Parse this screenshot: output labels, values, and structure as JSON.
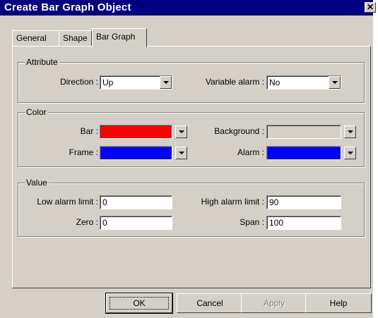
{
  "window": {
    "title": "Create Bar Graph  Object",
    "close_glyph": "✕"
  },
  "tabs": [
    {
      "label": "General"
    },
    {
      "label": "Shape"
    },
    {
      "label": "Bar Graph"
    }
  ],
  "attribute": {
    "legend": "Attribute",
    "direction_label": "Direction :",
    "direction_value": "Up",
    "variable_alarm_label": "Variable alarm :",
    "variable_alarm_value": "No"
  },
  "color": {
    "legend": "Color",
    "bar_label": "Bar :",
    "bar_color": "#ff0000",
    "background_label": "Background :",
    "background_color": "#d4d0c8",
    "frame_label": "Frame :",
    "frame_color": "#0000ff",
    "alarm_label": "Alarm :",
    "alarm_color": "#0000ff"
  },
  "value": {
    "legend": "Value",
    "low_alarm_label": "Low alarm limit :",
    "low_alarm_value": "0",
    "high_alarm_label": "High alarm limit :",
    "high_alarm_value": "90",
    "zero_label": "Zero :",
    "zero_value": "0",
    "span_label": "Span :",
    "span_value": "100"
  },
  "buttons": {
    "ok": "OK",
    "cancel": "Cancel",
    "apply": "Apply",
    "help": "Help"
  }
}
